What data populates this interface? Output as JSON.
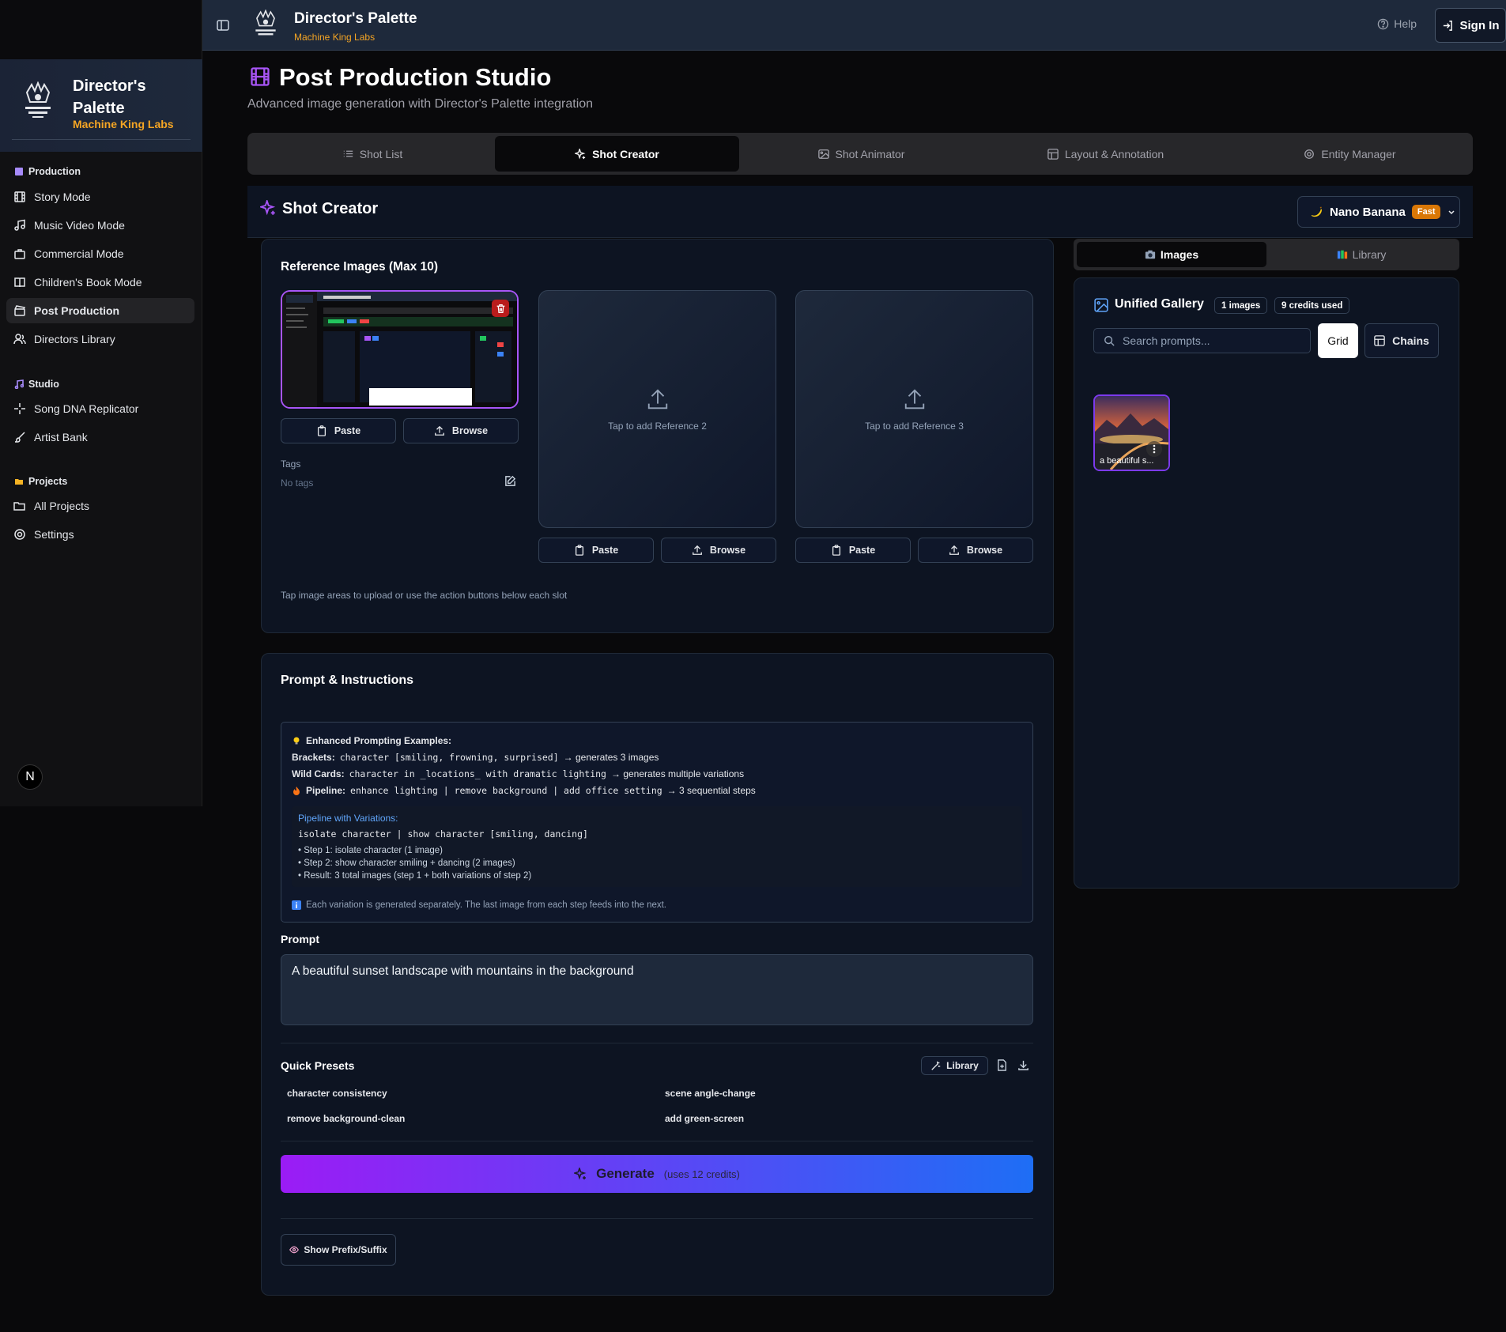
{
  "app": {
    "title": "Director's Palette",
    "subtitle": "Machine King Labs"
  },
  "sidebar": {
    "brand_title": "Director's Palette",
    "brand_subtitle": "Machine King Labs",
    "sections": [
      {
        "label": "Production",
        "items": [
          "Story Mode",
          "Music Video Mode",
          "Commercial Mode",
          "Children's Book Mode",
          "Post Production",
          "Directors Library"
        ]
      },
      {
        "label": "Studio",
        "items": [
          "Song DNA Replicator",
          "Artist Bank"
        ]
      },
      {
        "label": "Projects",
        "items": [
          "All Projects",
          "Settings"
        ]
      }
    ],
    "active_item": "Post Production",
    "avatar_letter": "N"
  },
  "topbar": {
    "help": "Help",
    "sign_in": "Sign In"
  },
  "page": {
    "title": "Post Production Studio",
    "subtitle": "Advanced image generation with Director's Palette integration"
  },
  "tabs": [
    "Shot List",
    "Shot Creator",
    "Shot Animator",
    "Layout & Annotation",
    "Entity Manager"
  ],
  "active_tab": "Shot Creator",
  "shot_creator": {
    "title": "Shot Creator",
    "model": "Nano Banana",
    "model_badge": "Fast"
  },
  "reference": {
    "title": "Reference Images (Max 10)",
    "slot2": "Tap to add Reference 2",
    "slot3": "Tap to add Reference 3",
    "paste": "Paste",
    "browse": "Browse",
    "tags_label": "Tags",
    "tags_empty": "No tags",
    "hint": "Tap image areas to upload or use the action buttons below each slot"
  },
  "prompt_section": {
    "title": "Prompt & Instructions",
    "examples_title": "Enhanced Prompting Examples:",
    "brackets_label": "Brackets:",
    "brackets_code": "character [smiling, frowning, surprised]",
    "brackets_result": "→ generates 3 images",
    "wildcards_label": "Wild Cards:",
    "wildcards_code": "character in _locations_ with dramatic lighting",
    "wildcards_result": "→ generates multiple variations",
    "pipeline_label": "Pipeline:",
    "pipeline_code": "enhance lighting | remove background | add office setting",
    "pipeline_result": "→ 3 sequential steps",
    "pv_title": "Pipeline with Variations:",
    "pv_code": "isolate character | show character [smiling, dancing]",
    "pv_steps": [
      "• Step 1: isolate character (1 image)",
      "• Step 2: show character smiling + dancing (2 images)",
      "• Result: 3 total images (step 1 + both variations of step 2)"
    ],
    "note": "Each variation is generated separately. The last image from each step feeds into the next.",
    "prompt_label": "Prompt",
    "prompt_value": "A beautiful sunset landscape with mountains in the background",
    "presets_title": "Quick Presets",
    "library_btn": "Library",
    "presets": [
      "character consistency",
      "scene angle-change",
      "remove background-clean",
      "add green-screen"
    ],
    "generate": "Generate",
    "generate_cost": "(uses 12 credits)",
    "prefix_btn": "Show Prefix/Suffix"
  },
  "gallery": {
    "tab_images": "Images",
    "tab_library": "Library",
    "title": "Unified Gallery",
    "count": "1 images",
    "credits": "9 credits used",
    "search_placeholder": "Search prompts...",
    "grid": "Grid",
    "chains": "Chains",
    "thumb_caption": "a beautiful s..."
  },
  "colors": {
    "accent_purple": "#a855f7",
    "brand_orange": "#f5a524",
    "topbar": "#1e293b"
  }
}
